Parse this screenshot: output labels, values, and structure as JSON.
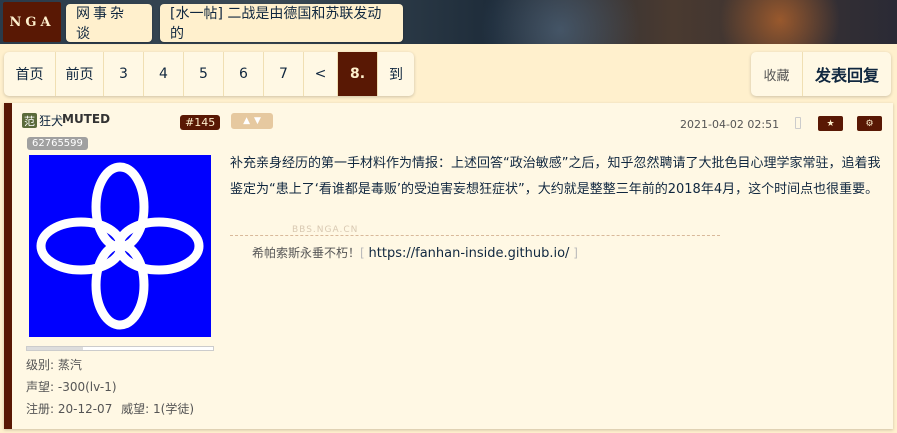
{
  "header": {
    "logo": "NGA",
    "crumbs": [
      "网事杂谈",
      "[水一帖] 二战是由德国和苏联发动的"
    ]
  },
  "pager": {
    "first": "首页",
    "prev": "前页",
    "pages": [
      "3",
      "4",
      "5",
      "6",
      "7"
    ],
    "back": "<",
    "current": "8.",
    "goto": "到"
  },
  "actions": {
    "favorite": "收藏",
    "reply": "发表回复"
  },
  "post": {
    "badge": "范",
    "username": "狂犬",
    "muted_tag": "MUTED",
    "floor": "#145",
    "uid": "62765599",
    "time": "2021-04-02 02:51",
    "level": "级别: 蒸汽",
    "reputation": "声望: -300(lv-1)",
    "registered": "注册: 20-12-07",
    "prestige": "威望: 1(学徒)",
    "content": "补充亲身经历的第一手材料作为情报：上述回答“政治敏感”之后，知乎忽然聘请了大批色目心理学家常驻，追着我鉴定为“患上了‘看谁都是毒贩’的受迫害妄想狂症状”，大约就是整整三年前的2018年4月，这个时间点也很重要。",
    "watermark": "BBS.NGA.CN",
    "signature_text": "希帕索斯永垂不朽！",
    "signature_link": "https://fanhan-inside.github.io/"
  },
  "colors": {
    "accent": "#591804",
    "background": "#fff0cd",
    "avatar": "#0000ff"
  }
}
